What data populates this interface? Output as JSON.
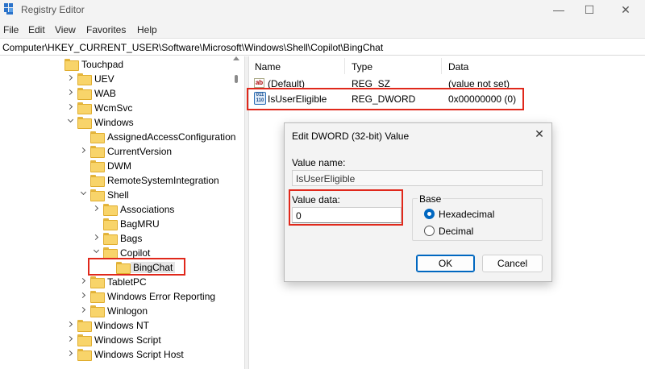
{
  "window": {
    "title": "Registry Editor",
    "minimize": "—",
    "maximize": "☐",
    "close": "✕"
  },
  "menu": [
    "File",
    "Edit",
    "View",
    "Favorites",
    "Help"
  ],
  "address": "Computer\\HKEY_CURRENT_USER\\Software\\Microsoft\\Windows\\Shell\\Copilot\\BingChat",
  "tree": [
    {
      "label": "Touchpad",
      "expander": "none"
    },
    {
      "label": "UEV",
      "expander": "right"
    },
    {
      "label": "WAB",
      "expander": "right"
    },
    {
      "label": "WcmSvc",
      "expander": "right"
    },
    {
      "label": "Windows",
      "expander": "down"
    },
    {
      "label": "AssignedAccessConfiguration",
      "expander": "none"
    },
    {
      "label": "CurrentVersion",
      "expander": "right"
    },
    {
      "label": "DWM",
      "expander": "none"
    },
    {
      "label": "RemoteSystemIntegration",
      "expander": "none"
    },
    {
      "label": "Shell",
      "expander": "down"
    },
    {
      "label": "Associations",
      "expander": "right"
    },
    {
      "label": "BagMRU",
      "expander": "none"
    },
    {
      "label": "Bags",
      "expander": "right"
    },
    {
      "label": "Copilot",
      "expander": "down"
    },
    {
      "label": "BingChat",
      "expander": "none",
      "selected": true
    },
    {
      "label": "TabletPC",
      "expander": "right"
    },
    {
      "label": "Windows Error Reporting",
      "expander": "right"
    },
    {
      "label": "Winlogon",
      "expander": "right"
    },
    {
      "label": "Windows NT",
      "expander": "right"
    },
    {
      "label": "Windows Script",
      "expander": "right"
    },
    {
      "label": "Windows Script Host",
      "expander": "right"
    }
  ],
  "columns": {
    "name": "Name",
    "type": "Type",
    "data": "Data"
  },
  "values": [
    {
      "name": "(Default)",
      "type": "REG_SZ",
      "data": "(value not set)",
      "icon": "string-value-icon",
      "icon_text": "ab"
    },
    {
      "name": "IsUserEligible",
      "type": "REG_DWORD",
      "data": "0x00000000 (0)",
      "icon": "binary-value-icon",
      "icon_text": "011 110"
    }
  ],
  "dialog": {
    "title": "Edit DWORD (32-bit) Value",
    "close": "✕",
    "value_name_label": "Value name:",
    "value_name": "IsUserEligible",
    "value_data_label": "Value data:",
    "value_data": "0",
    "base_label": "Base",
    "hex_label": "Hexadecimal",
    "dec_label": "Decimal",
    "base_selected": "Hexadecimal",
    "ok_label": "OK",
    "cancel_label": "Cancel"
  },
  "highlight_color": "#e0281b",
  "accent_color": "#0067c0"
}
